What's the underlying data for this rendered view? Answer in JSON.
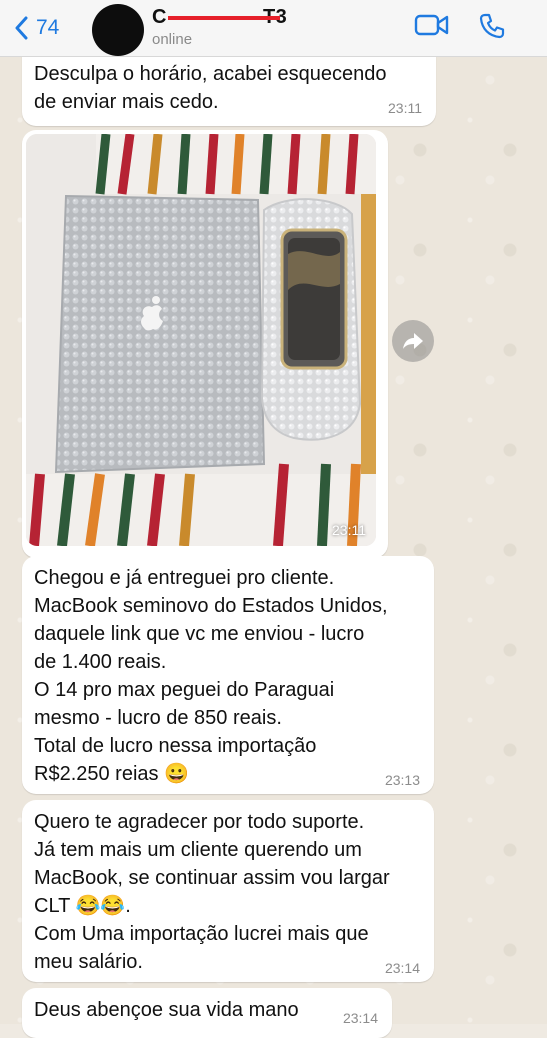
{
  "header": {
    "back_count": "74",
    "contact_name_visible_start": "C",
    "contact_name_visible_end": "T3",
    "status": "online"
  },
  "messages": [
    {
      "type": "text",
      "text": "Desculpa o horário, acabei esquecendo\nde enviar mais cedo.",
      "time": "23:11"
    },
    {
      "type": "image",
      "time": "23:11"
    },
    {
      "type": "text",
      "text": "Chegou e já entreguei pro cliente.\nMacBook seminovo do Estados Unidos,\ndaquele link que vc me enviou - lucro\nde 1.400 reais.\nO 14 pro max peguei do Paraguai\nmesmo - lucro de 850 reais.\nTotal de lucro nessa importação\nR$2.250 reias 😀",
      "time": "23:13"
    },
    {
      "type": "text",
      "text": "Quero te agradecer por todo suporte.\nJá tem mais um cliente querendo um\nMacBook, se continuar assim vou largar\nCLT 😂😂.\nCom Uma importação lucrei mais que\nmeu salário.",
      "time": "23:14"
    },
    {
      "type": "text",
      "text": "Deus abençoe sua vida mano",
      "time": "23:14"
    }
  ],
  "icons": {
    "back": "chevron-left-icon",
    "video": "video-camera-icon",
    "call": "phone-icon",
    "forward": "forward-arrow-icon"
  },
  "colors": {
    "accent": "#1f7ae0",
    "bubble": "#ffffff",
    "chat_background": "#ece6dc",
    "redaction": "#e6202a"
  }
}
